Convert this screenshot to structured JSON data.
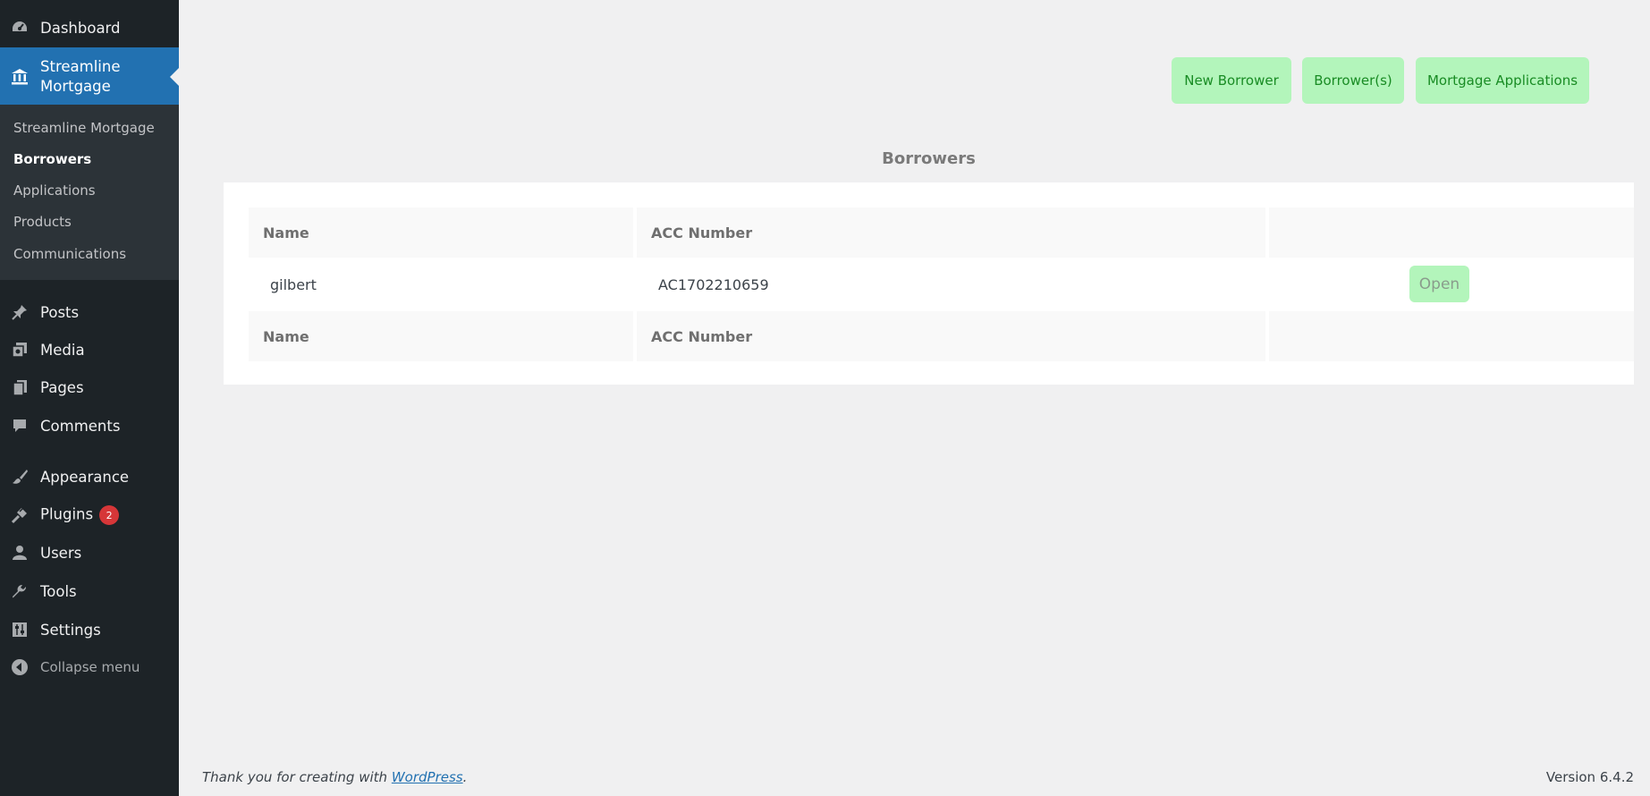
{
  "sidebar": {
    "dashboard": {
      "label": "Dashboard",
      "icon": "dashboard-icon"
    },
    "streamline_mortgage": {
      "label": "Streamline Mortgage",
      "icon": "bank-icon"
    },
    "submenu": [
      {
        "label": "Streamline Mortgage"
      },
      {
        "label": "Borrowers"
      },
      {
        "label": "Applications"
      },
      {
        "label": "Products"
      },
      {
        "label": "Communications"
      }
    ],
    "posts": {
      "label": "Posts",
      "icon": "pushpin-icon"
    },
    "media": {
      "label": "Media",
      "icon": "media-icon"
    },
    "pages": {
      "label": "Pages",
      "icon": "pages-icon"
    },
    "comments": {
      "label": "Comments",
      "icon": "comment-icon"
    },
    "appearance": {
      "label": "Appearance",
      "icon": "paintbrush-icon"
    },
    "plugins": {
      "label": "Plugins",
      "icon": "plugin-icon",
      "badge": "2"
    },
    "users": {
      "label": "Users",
      "icon": "user-icon"
    },
    "tools": {
      "label": "Tools",
      "icon": "wrench-icon"
    },
    "settings": {
      "label": "Settings",
      "icon": "settings-icon"
    },
    "collapse": {
      "label": "Collapse menu",
      "icon": "collapse-icon"
    }
  },
  "toolbar": {
    "new_borrower": "New Borrower",
    "borrowers": "Borrower(s)",
    "mortgage_applications": "Mortgage Applications"
  },
  "main": {
    "title": "Borrowers",
    "table": {
      "columns": [
        "Name",
        "ACC Number",
        ""
      ],
      "rows": [
        {
          "name": "gilbert",
          "acc_number": "AC1702210659",
          "action": "Open"
        }
      ],
      "footer_columns": [
        "Name",
        "ACC Number",
        ""
      ]
    }
  },
  "footer": {
    "thanks_prefix": "Thank you for creating with ",
    "thanks_link": "WordPress",
    "thanks_suffix": ".",
    "version": "Version 6.4.2"
  },
  "colors": {
    "sidebar_bg": "#1d2327",
    "submenu_bg": "#2c3338",
    "current_menu_bg": "#2271b1",
    "button_bg": "#b3f5bb",
    "button_text": "#198c24",
    "badge_bg": "#d63638"
  }
}
